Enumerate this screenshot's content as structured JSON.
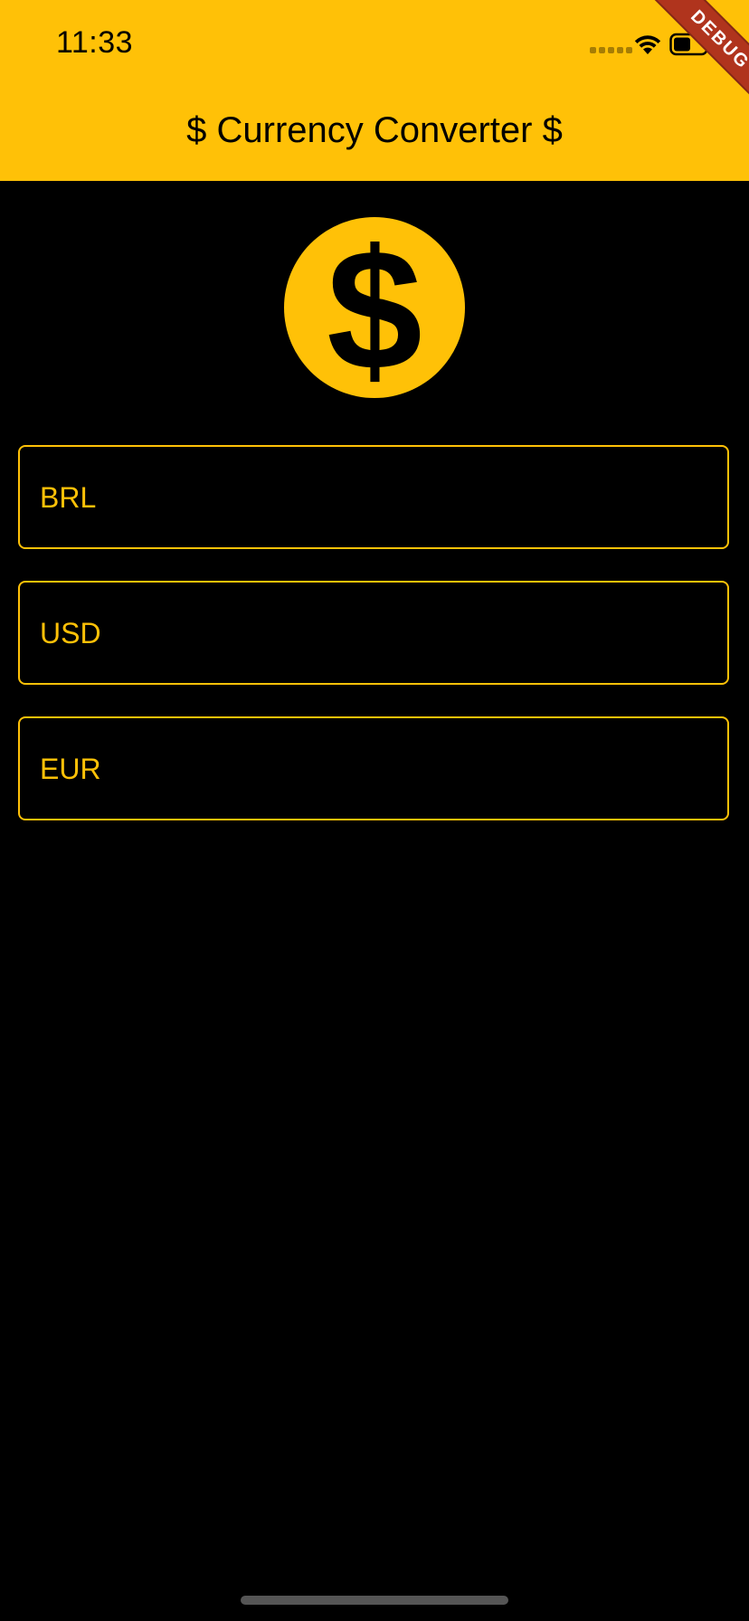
{
  "status_bar": {
    "time": "11:33",
    "icons": [
      "signal-dots-icon",
      "wifi-icon",
      "battery-icon"
    ]
  },
  "debug_banner": {
    "label": "DEBUG",
    "color": "#B0341D"
  },
  "app_bar": {
    "title": "$ Currency Converter $",
    "background": "#FFC107"
  },
  "logo": {
    "icon": "dollar-sign-icon",
    "color": "#FFC107"
  },
  "fields": [
    {
      "label": "BRL",
      "value": ""
    },
    {
      "label": "USD",
      "value": ""
    },
    {
      "label": "EUR",
      "value": ""
    }
  ],
  "theme": {
    "accent": "#FFC107",
    "background": "#000000"
  }
}
